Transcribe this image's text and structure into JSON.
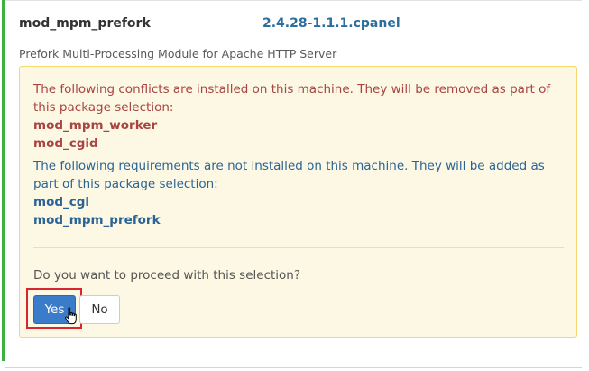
{
  "package": {
    "name": "mod_mpm_prefork",
    "version": "2.4.28-1.1.1.cpanel",
    "description": "Prefork Multi-Processing Module for Apache HTTP Server"
  },
  "conflicts": {
    "message": "The following conflicts are installed on this machine. They will be removed as part of this package selection:",
    "items": [
      "mod_mpm_worker",
      "mod_cgid"
    ]
  },
  "requirements": {
    "message": "The following requirements are not installed on this machine. They will be added as part of this package selection:",
    "items": [
      "mod_cgi",
      "mod_mpm_prefork"
    ]
  },
  "confirm": {
    "question": "Do you want to proceed with this selection?",
    "yes_label": "Yes",
    "no_label": "No"
  },
  "colors": {
    "status_bar": "#3cb043",
    "warning_bg": "#fcf8e3",
    "conflict_text": "#a94442",
    "requirement_text": "#2a6496",
    "primary_button": "#3a7cc9",
    "highlight": "#d9262c"
  },
  "icons": {
    "cursor": "hand-pointer-icon"
  }
}
